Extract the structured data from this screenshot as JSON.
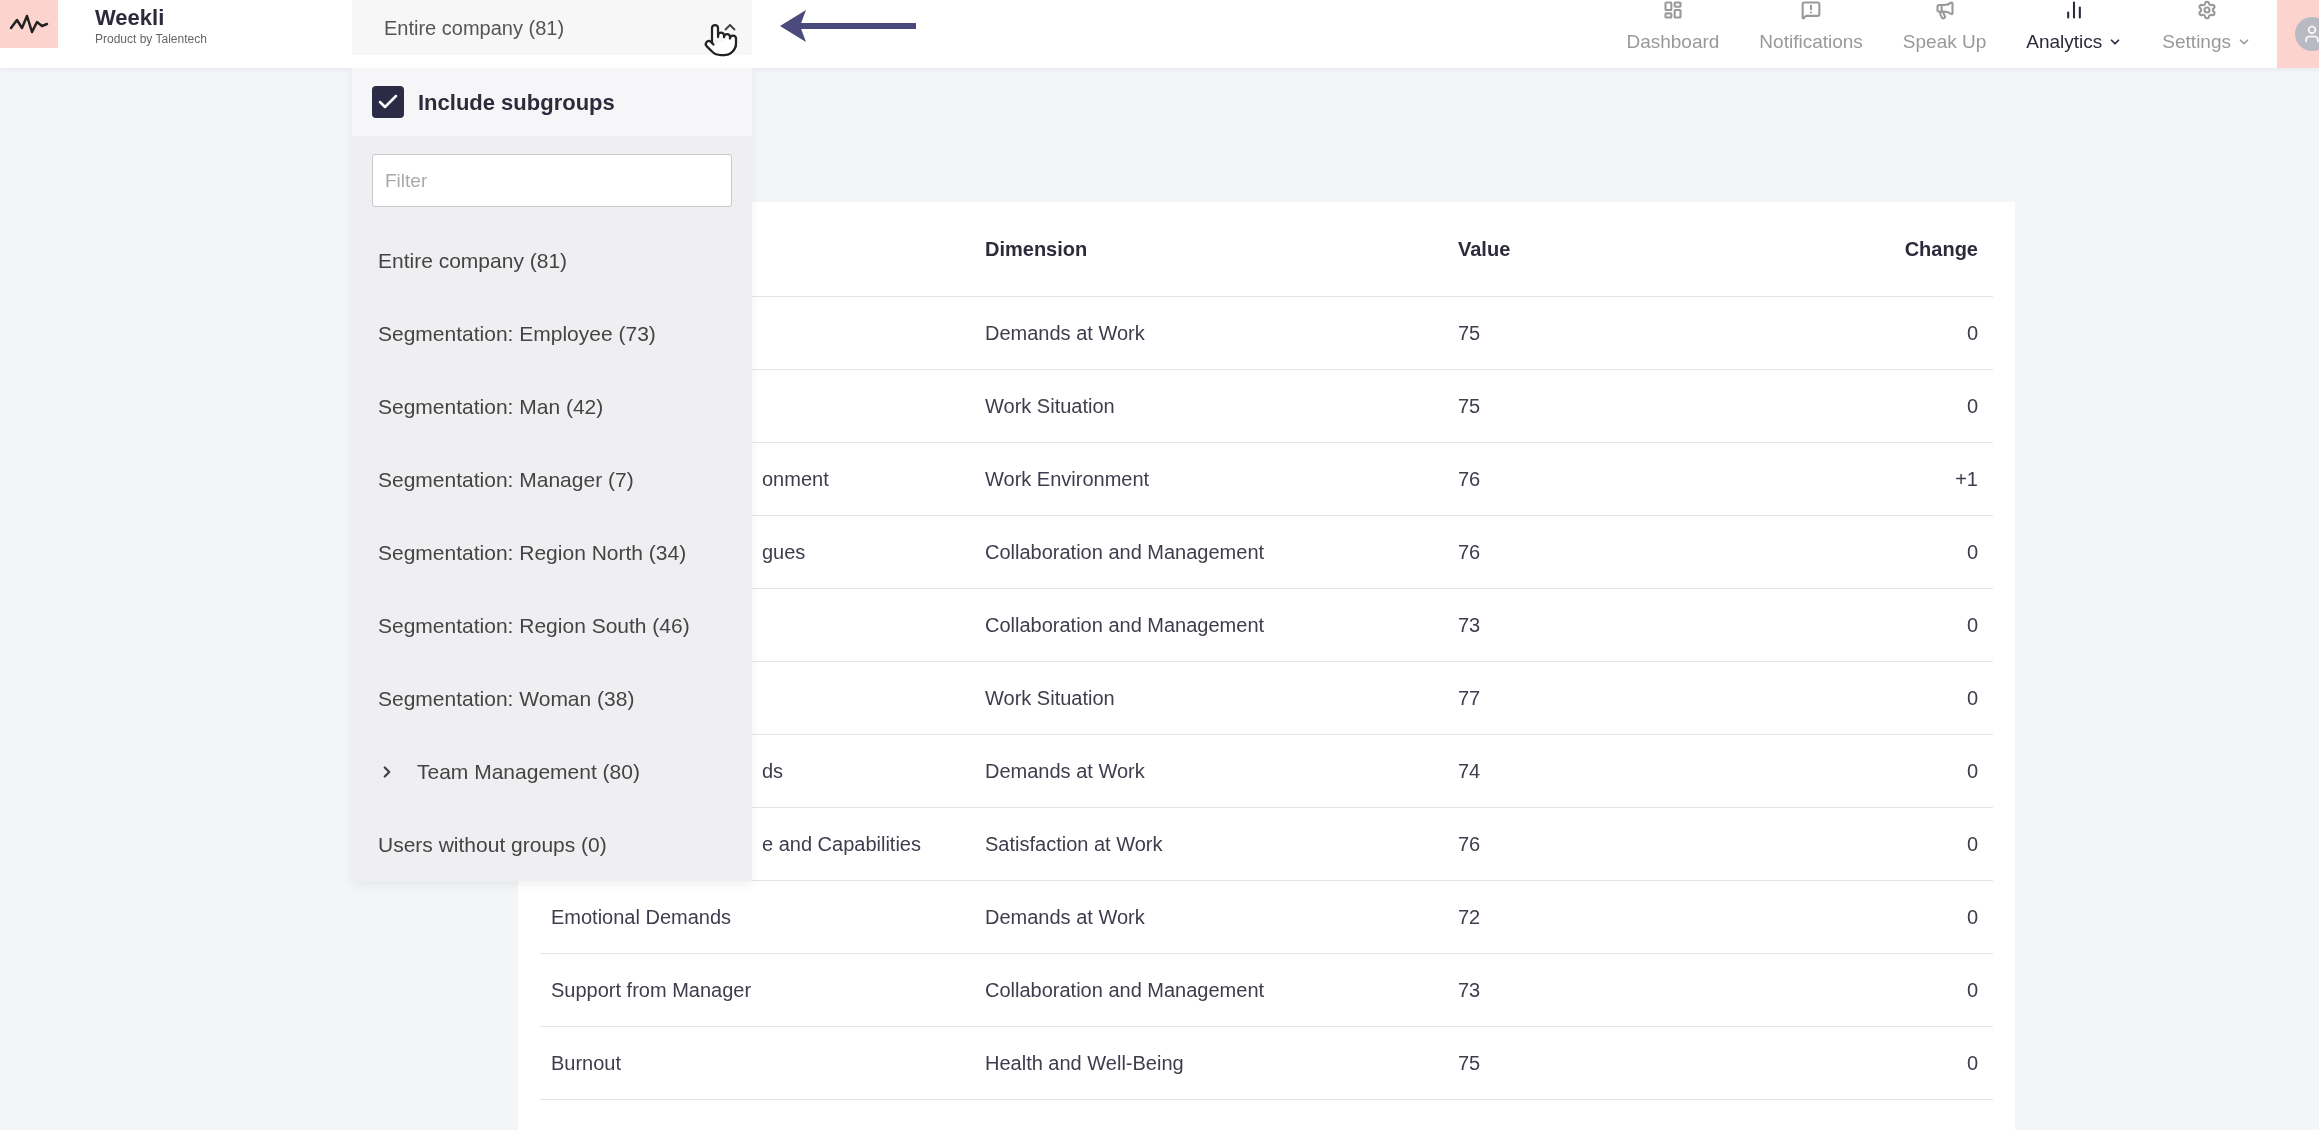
{
  "app": {
    "name": "Weekli",
    "tagline": "Product by Talentech"
  },
  "group_select": {
    "value": "Entire company (81)",
    "expanded": true
  },
  "nav": [
    {
      "label": "Dashboard",
      "kind": "dashboard",
      "selected": false,
      "has_menu": false
    },
    {
      "label": "Notifications",
      "kind": "notifications",
      "selected": false,
      "has_menu": false
    },
    {
      "label": "Speak Up",
      "kind": "speakup",
      "selected": false,
      "has_menu": false
    },
    {
      "label": "Analytics",
      "kind": "analytics",
      "selected": true,
      "has_menu": true
    },
    {
      "label": "Settings",
      "kind": "settings",
      "selected": false,
      "has_menu": true
    }
  ],
  "dropdown": {
    "include_subgroups": {
      "label": "Include subgroups",
      "checked": true
    },
    "filter": {
      "placeholder": "Filter"
    },
    "items": [
      {
        "label": "Entire company (81)",
        "has_children": false
      },
      {
        "label": "Segmentation: Employee (73)",
        "has_children": false
      },
      {
        "label": "Segmentation: Man (42)",
        "has_children": false
      },
      {
        "label": "Segmentation: Manager (7)",
        "has_children": false
      },
      {
        "label": "Segmentation: Region North (34)",
        "has_children": false
      },
      {
        "label": "Segmentation: Region South (46)",
        "has_children": false
      },
      {
        "label": "Segmentation: Woman (38)",
        "has_children": false
      },
      {
        "label": "Team Management (80)",
        "has_children": true
      },
      {
        "label": "Users without groups (0)",
        "has_children": false
      }
    ]
  },
  "table": {
    "columns": [
      "Dimension",
      "Value",
      "Change"
    ],
    "rows": [
      {
        "dimension": "Demands at Work",
        "value": "75",
        "change": "0"
      },
      {
        "dimension": "Work Situation",
        "value": "75",
        "change": "0"
      },
      {
        "covered": true,
        "column_1": "onment",
        "dimension": "Work Environment",
        "value": "76",
        "change": "+1"
      },
      {
        "covered": true,
        "column_1": "gues",
        "dimension": "Collaboration and Management",
        "value": "76",
        "change": "0"
      },
      {
        "dimension": "Collaboration and Management",
        "value": "73",
        "change": "0"
      },
      {
        "dimension": "Work Situation",
        "value": "77",
        "change": "0"
      },
      {
        "covered": true,
        "column_1": "ds",
        "dimension": "Demands at Work",
        "value": "74",
        "change": "0"
      },
      {
        "covered": true,
        "column_1": "e and Capabilities",
        "dimension": "Satisfaction at Work",
        "value": "76",
        "change": "0"
      },
      {
        "covered": false,
        "column_1": "Emotional Demands",
        "dimension": "Demands at Work",
        "value": "72",
        "change": "0"
      },
      {
        "covered": false,
        "column_1": "Support from Manager",
        "dimension": "Collaboration and Management",
        "value": "73",
        "change": "0"
      },
      {
        "covered": false,
        "column_1": "Burnout",
        "dimension": "Health and Well-Being",
        "value": "75",
        "change": "0"
      }
    ]
  }
}
